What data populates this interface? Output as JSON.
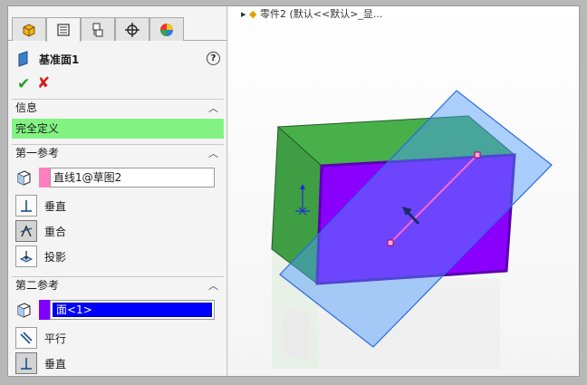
{
  "viewport": {
    "tree_title": "零件2 (默认<<默认>_显..."
  },
  "feature": {
    "title": "基准面1",
    "help": "?"
  },
  "actions": {
    "ok": "✔",
    "cancel": "✘"
  },
  "info": {
    "header": "信息",
    "status": "完全定义"
  },
  "first_reference": {
    "header": "第一参考",
    "selection": "直线1@草图2",
    "selection_color": "#ff7ec0",
    "options": [
      "垂直",
      "重合",
      "投影"
    ],
    "active": "重合"
  },
  "second_reference": {
    "header": "第二参考",
    "selection": "面<1>",
    "selection_color": "#8000ff",
    "options": [
      "平行",
      "垂直"
    ],
    "active": "垂直"
  },
  "colors": {
    "defined_green": "#82f382",
    "selected_face": "#8a00ff",
    "plane_blue": "#4a9aff",
    "body_green": "#47b04b"
  }
}
